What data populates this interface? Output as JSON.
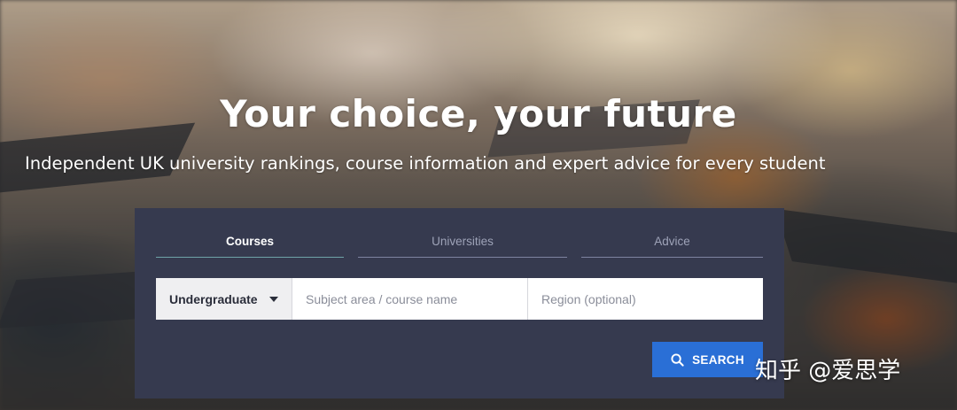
{
  "hero": {
    "title": "Your choice, your future",
    "subtitle": "Independent UK university rankings, course information and expert advice for every student"
  },
  "search": {
    "tabs": [
      {
        "label": "Courses",
        "active": true
      },
      {
        "label": "Universities",
        "active": false
      },
      {
        "label": "Advice",
        "active": false
      }
    ],
    "level_select": {
      "value": "Undergraduate"
    },
    "subject_input": {
      "placeholder": "Subject area / course name",
      "value": ""
    },
    "region_input": {
      "placeholder": "Region (optional)",
      "value": ""
    },
    "submit_label": "SEARCH"
  },
  "watermark": "知乎 @爱思学",
  "colors": {
    "panel_bg": "#363a4f",
    "button_bg": "#2a6fd6",
    "active_tab_underline": "#6fa3a8"
  },
  "icons": {
    "dropdown": "caret-down-icon",
    "search": "search-icon"
  }
}
